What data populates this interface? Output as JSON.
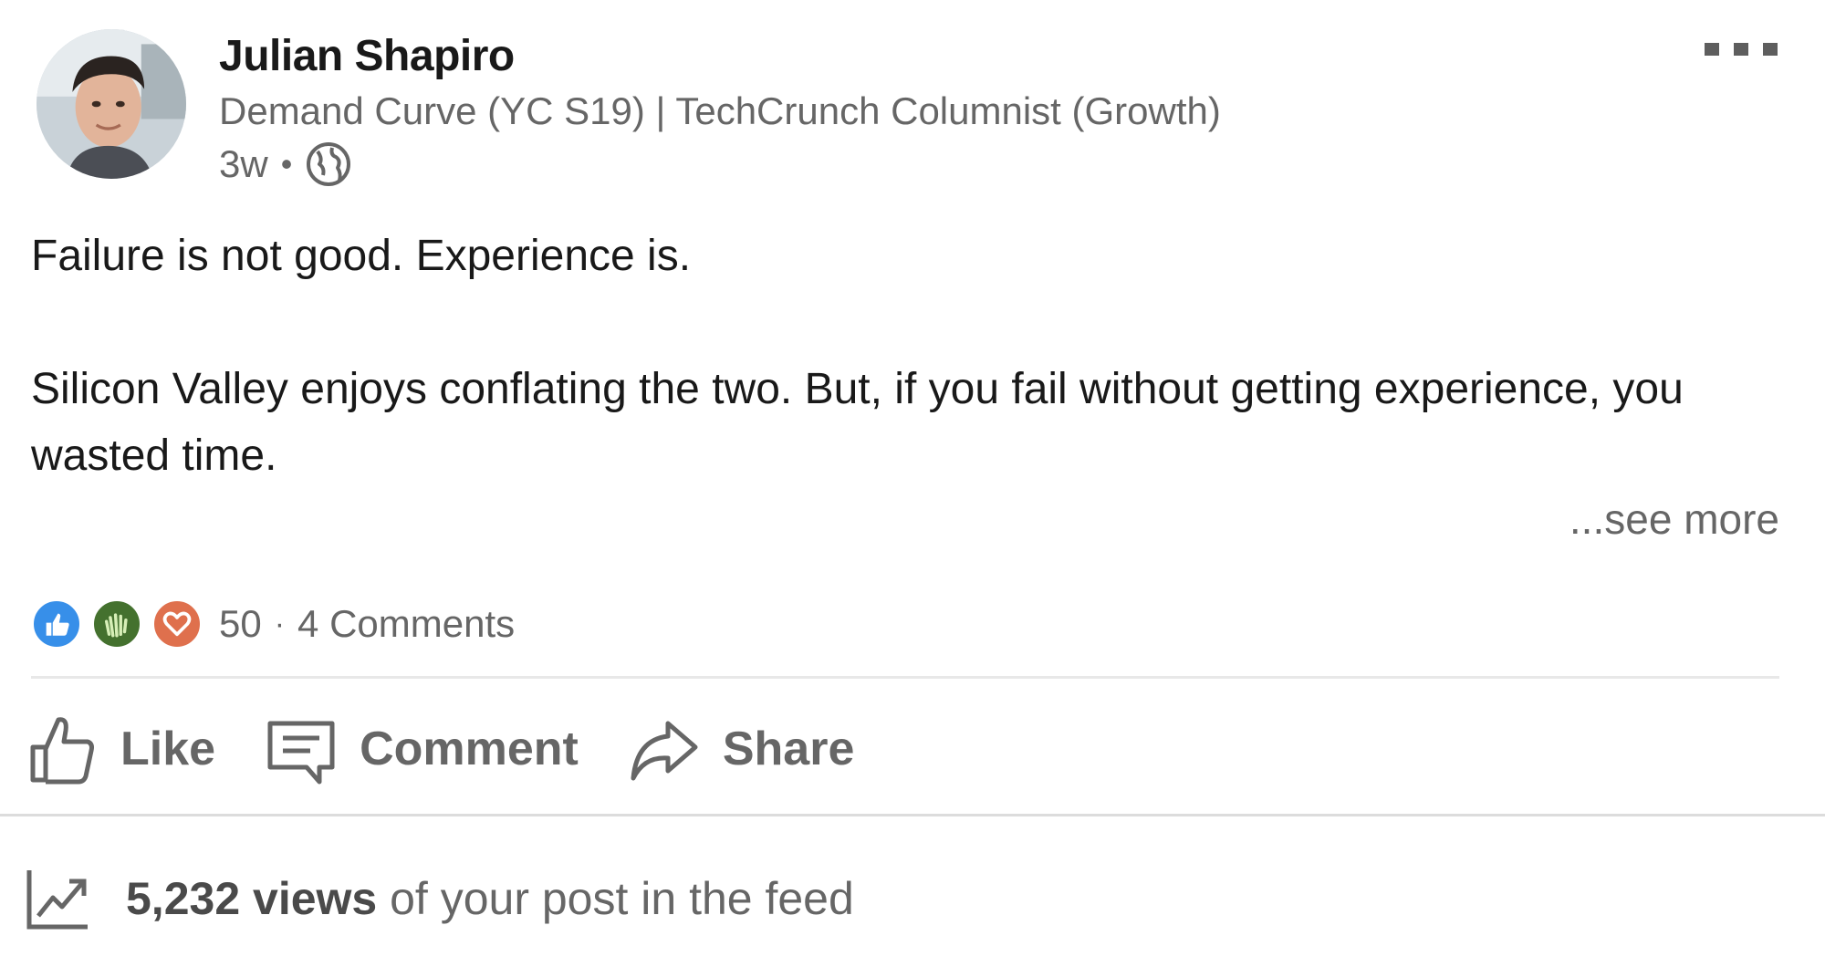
{
  "author": {
    "name": "Julian Shapiro",
    "headline": "Demand Curve (YC S19) | TechCrunch Columnist (Growth)",
    "time_ago": "3w",
    "separator": "•",
    "visibility_icon": "globe-icon"
  },
  "menu": {
    "icon": "overflow-menu-icon"
  },
  "post": {
    "paragraph_1": "Failure is not good. Experience is.",
    "paragraph_2": "Silicon Valley enjoys conflating the two. But, if you fail without getting experience, you wasted time.",
    "see_more": "...see more"
  },
  "social": {
    "reaction_icons": [
      "like-reaction-icon",
      "celebrate-reaction-icon",
      "love-reaction-icon"
    ],
    "reaction_count": "50",
    "separator": "·",
    "comments": "4 Comments"
  },
  "actions": [
    {
      "label": "Like",
      "icon": "thumbs-up-icon"
    },
    {
      "label": "Comment",
      "icon": "comment-icon"
    },
    {
      "label": "Share",
      "icon": "share-arrow-icon"
    }
  ],
  "analytics": {
    "icon": "trending-chart-icon",
    "views": "5,232 views",
    "suffix": " of your post in the feed"
  },
  "colors": {
    "text_primary": "#191919",
    "text_secondary": "#666666",
    "like_blue": "#378fe9",
    "celebrate_green": "#44712e",
    "love_orange": "#df704d",
    "divider": "#e8e8e8"
  }
}
